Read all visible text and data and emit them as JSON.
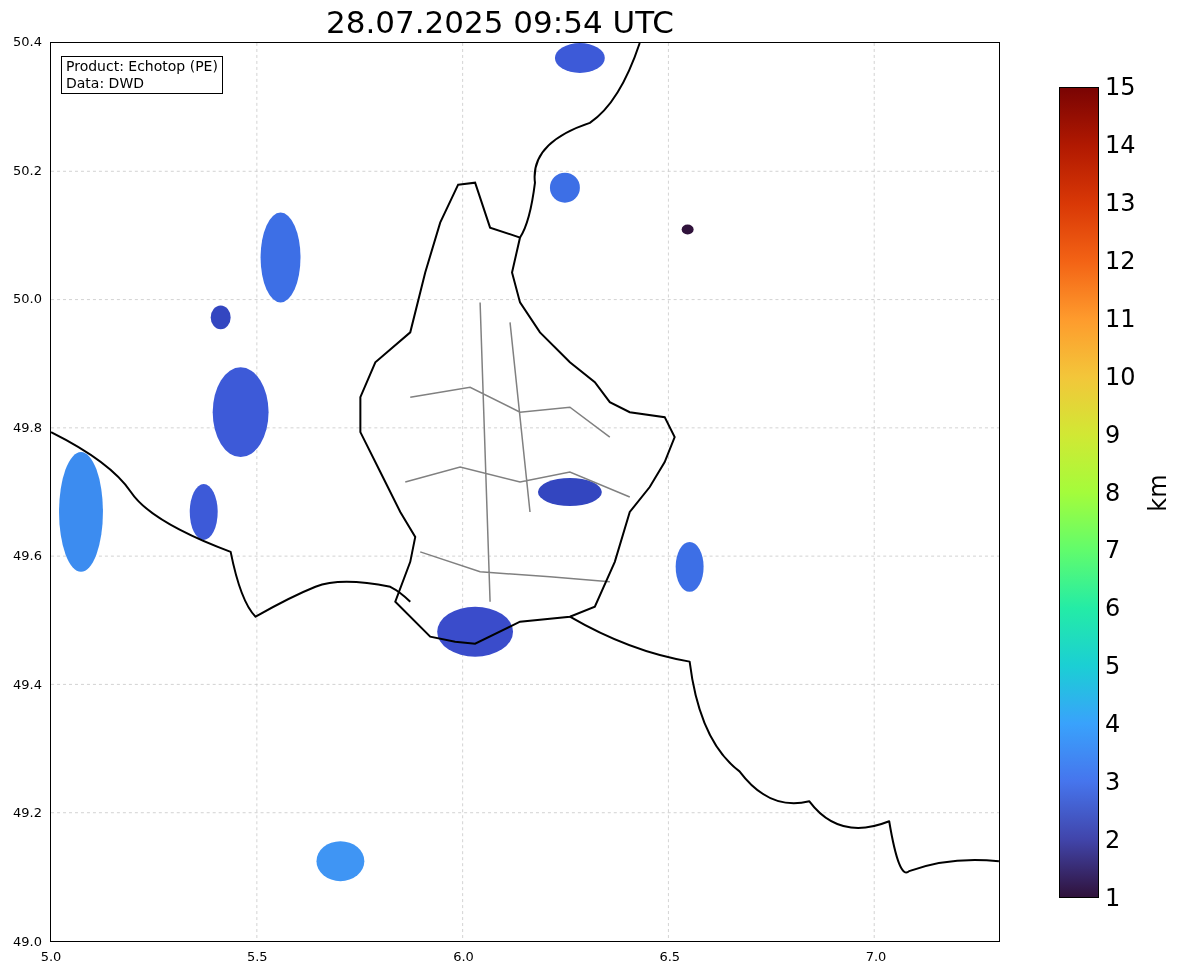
{
  "title": "28.07.2025 09:54 UTC",
  "map": {
    "kind": "map-picture"
  },
  "info_box": [
    "Product: Echotop (PE)",
    "Data: DWD"
  ],
  "x_ticks": [
    "5.0",
    "5.5",
    "6.0",
    "6.5",
    "7.0"
  ],
  "y_ticks": [
    "50.4",
    "50.2",
    "50.0",
    "49.8",
    "49.6",
    "49.4",
    "49.2",
    "49.0"
  ],
  "colorbar": {
    "label": "km",
    "ticks": [
      "15",
      "14",
      "13",
      "12",
      "11",
      "10",
      "9",
      "8",
      "7",
      "6",
      "5",
      "4",
      "3",
      "2",
      "1"
    ]
  }
}
